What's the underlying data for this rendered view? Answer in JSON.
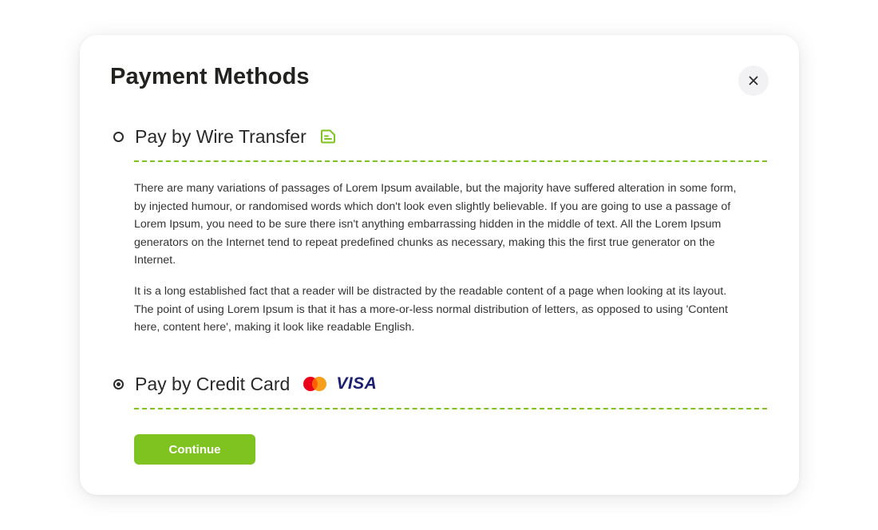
{
  "modal": {
    "title": "Payment Methods",
    "close_icon": "close-icon"
  },
  "payment_options": [
    {
      "label": "Pay by Wire Transfer",
      "selected": false,
      "icon": "invoice-icon",
      "description": [
        "There are many variations of passages of Lorem Ipsum available, but the majority have suffered alteration in some form, by injected humour, or randomised words which don't look even slightly believable. If you are going to use a passage of Lorem Ipsum, you need to be sure there isn't anything embarrassing hidden in the middle of text. All the Lorem Ipsum generators on the Internet tend to repeat predefined chunks as necessary, making this the first true generator on the Internet.",
        "It is a long established fact that a reader will be distracted by the readable content of a page when looking at its layout. The point of using Lorem Ipsum is that it has a more-or-less normal distribution of letters, as opposed to using 'Content here, content here', making it look like readable English."
      ]
    },
    {
      "label": "Pay by Credit Card",
      "selected": true,
      "icons": [
        "mastercard-logo",
        "visa-logo"
      ],
      "visa_text": "VISA"
    }
  ],
  "actions": {
    "continue_label": "Continue"
  },
  "colors": {
    "accent": "#7ec320",
    "title_text": "#22231f",
    "body_text": "#343434",
    "close_bg": "#f2f2f4",
    "mastercard_red": "#eb001b",
    "mastercard_orange": "#f79e1b",
    "visa_blue": "#1a1f71"
  }
}
